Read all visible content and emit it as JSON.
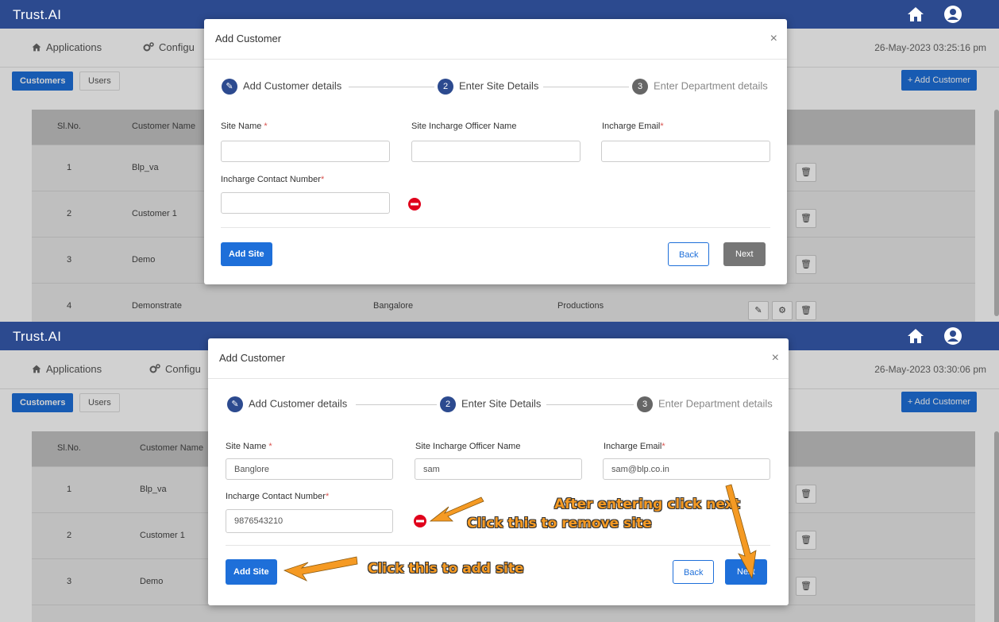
{
  "app": {
    "brand": "Trust.AI"
  },
  "nav": {
    "applications": "Applications",
    "configure": "Configu"
  },
  "panels": [
    {
      "datetime": "26-May-2023 03:25:16 pm"
    },
    {
      "datetime": "26-May-2023 03:30:06 pm"
    }
  ],
  "subtabs": {
    "customers": "Customers",
    "users": "Users",
    "add_customer": "+ Add Customer"
  },
  "table": {
    "headers": {
      "slno": "Sl.No.",
      "name": "Customer Name"
    },
    "rows": [
      {
        "no": "1",
        "name": "Blp_va"
      },
      {
        "no": "2",
        "name": "Customer 1"
      },
      {
        "no": "3",
        "name": "Demo"
      },
      {
        "no": "4",
        "name": "Demonstrate",
        "location": "Bangalore",
        "dept": "Productions"
      }
    ]
  },
  "modal": {
    "title": "Add Customer",
    "close": "×",
    "steps": {
      "one": "Add Customer details",
      "two": "Enter Site Details",
      "three": "Enter Department details",
      "two_no": "2",
      "three_no": "3"
    },
    "fields": {
      "site_name": "Site Name",
      "officer": "Site Incharge Officer Name",
      "email": "Incharge Email",
      "contact": "Incharge Contact Number",
      "required": "*"
    },
    "filled": {
      "site_name": "Banglore",
      "officer": "sam",
      "email": "sam@blp.co.in",
      "contact": "9876543210"
    },
    "buttons": {
      "add_site": "Add Site",
      "back": "Back",
      "next": "Next"
    }
  },
  "annotations": {
    "next": "After entering click next",
    "remove": "Click this to remove site",
    "add": "Click this to add site"
  },
  "colors": {
    "topbar": "#2c4a8f",
    "primary": "#1e6fd9",
    "next_disabled": "#767676",
    "annotation": "#f59a23"
  }
}
